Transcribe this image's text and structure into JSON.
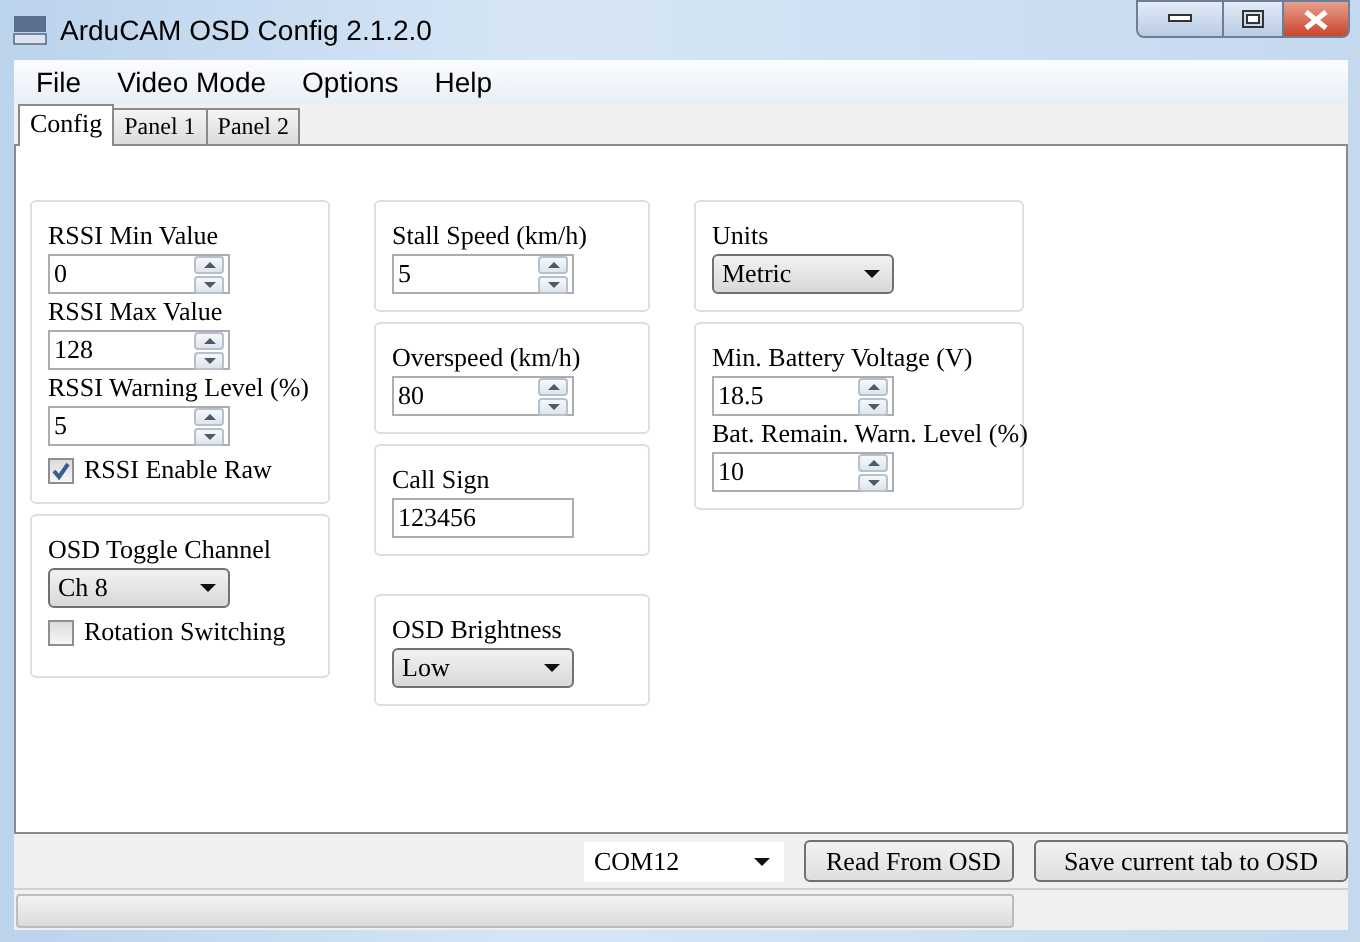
{
  "window": {
    "title": "ArduCAM OSD Config 2.1.2.0"
  },
  "menu": [
    "File",
    "Video Mode",
    "Options",
    "Help"
  ],
  "tabs": [
    {
      "label": "Config",
      "selected": true
    },
    {
      "label": "Panel 1",
      "selected": false
    },
    {
      "label": "Panel 2",
      "selected": false
    }
  ],
  "columns": [
    [
      {
        "fields": [
          {
            "kind": "spin",
            "label": "RSSI Min Value",
            "value": "0"
          },
          {
            "kind": "spin",
            "label": "RSSI Max Value",
            "value": "128"
          },
          {
            "kind": "spin",
            "label": "RSSI Warning Level (%)",
            "value": "5"
          },
          {
            "kind": "check",
            "label": "RSSI Enable Raw",
            "checked": true
          }
        ]
      },
      {
        "fields": [
          {
            "kind": "combo",
            "label": "OSD Toggle Channel",
            "value": "Ch 8"
          },
          {
            "kind": "check",
            "label": "Rotation Switching",
            "checked": false
          }
        ]
      }
    ],
    [
      {
        "fields": [
          {
            "kind": "spin",
            "label": "Stall Speed (km/h)",
            "value": "5"
          }
        ]
      },
      {
        "fields": [
          {
            "kind": "spin",
            "label": "Overspeed (km/h)",
            "value": "80"
          }
        ]
      },
      {
        "fields": [
          {
            "kind": "text",
            "label": "Call Sign",
            "value": "123456"
          }
        ]
      },
      {
        "fields": [
          {
            "kind": "combo",
            "label": "OSD Brightness",
            "value": "Low"
          }
        ]
      }
    ],
    [
      {
        "fields": [
          {
            "kind": "combo",
            "label": "Units",
            "value": "Metric"
          }
        ]
      },
      {
        "fields": [
          {
            "kind": "spin",
            "label": "Min. Battery Voltage (V)",
            "value": "18.5"
          },
          {
            "kind": "spin",
            "label": "Bat. Remain. Warn. Level (%)",
            "value": "10"
          }
        ]
      }
    ]
  ],
  "footer": {
    "port": "COM12",
    "buttons": [
      "Read From OSD",
      "Save current tab to OSD"
    ]
  },
  "status_bar": {
    "progress": {
      "level": 0
    }
  }
}
